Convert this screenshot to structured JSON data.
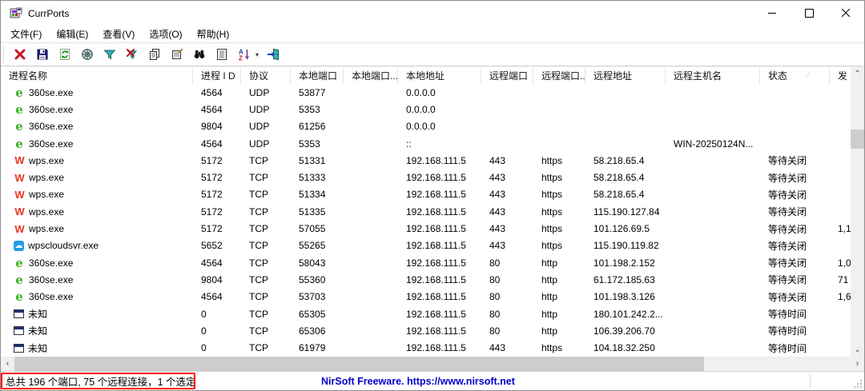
{
  "window": {
    "title": "CurrPorts"
  },
  "window_controls": {
    "minimize": "minimize",
    "maximize": "maximize",
    "close": "close"
  },
  "menu": [
    "文件(F)",
    "编辑(E)",
    "查看(V)",
    "选项(O)",
    "帮助(H)"
  ],
  "toolbar": {
    "icons": [
      "close-connection",
      "save",
      "refresh",
      "resolve-addresses",
      "filter",
      "clear-filter",
      "copy",
      "properties",
      "find",
      "report",
      "sort-az",
      "exit"
    ]
  },
  "table": {
    "columns": [
      "进程名称",
      "进程 I D",
      "协议",
      "本地端口",
      "本地端口...",
      "本地地址",
      "远程端口",
      "远程端口...",
      "远程地址",
      "远程主机名",
      "状态",
      "发"
    ],
    "rows": [
      {
        "icon": "360se",
        "process": "360se.exe",
        "pid": "4564",
        "proto": "UDP",
        "lport": "53877",
        "lportname": "",
        "laddr": "0.0.0.0",
        "rport": "",
        "rportname": "",
        "raddr": "",
        "rhost": "",
        "state": "",
        "sent": ""
      },
      {
        "icon": "360se",
        "process": "360se.exe",
        "pid": "4564",
        "proto": "UDP",
        "lport": "5353",
        "lportname": "",
        "laddr": "0.0.0.0",
        "rport": "",
        "rportname": "",
        "raddr": "",
        "rhost": "",
        "state": "",
        "sent": ""
      },
      {
        "icon": "360se",
        "process": "360se.exe",
        "pid": "9804",
        "proto": "UDP",
        "lport": "61256",
        "lportname": "",
        "laddr": "0.0.0.0",
        "rport": "",
        "rportname": "",
        "raddr": "",
        "rhost": "",
        "state": "",
        "sent": ""
      },
      {
        "icon": "360se",
        "process": "360se.exe",
        "pid": "4564",
        "proto": "UDP",
        "lport": "5353",
        "lportname": "",
        "laddr": "::",
        "rport": "",
        "rportname": "",
        "raddr": "",
        "rhost": "WIN-20250124N...",
        "state": "",
        "sent": ""
      },
      {
        "icon": "wps",
        "process": "wps.exe",
        "pid": "5172",
        "proto": "TCP",
        "lport": "51331",
        "lportname": "",
        "laddr": "192.168.111.5",
        "rport": "443",
        "rportname": "https",
        "raddr": "58.218.65.4",
        "rhost": "",
        "state": "等待关闭",
        "sent": ""
      },
      {
        "icon": "wps",
        "process": "wps.exe",
        "pid": "5172",
        "proto": "TCP",
        "lport": "51333",
        "lportname": "",
        "laddr": "192.168.111.5",
        "rport": "443",
        "rportname": "https",
        "raddr": "58.218.65.4",
        "rhost": "",
        "state": "等待关闭",
        "sent": ""
      },
      {
        "icon": "wps",
        "process": "wps.exe",
        "pid": "5172",
        "proto": "TCP",
        "lport": "51334",
        "lportname": "",
        "laddr": "192.168.111.5",
        "rport": "443",
        "rportname": "https",
        "raddr": "58.218.65.4",
        "rhost": "",
        "state": "等待关闭",
        "sent": ""
      },
      {
        "icon": "wps",
        "process": "wps.exe",
        "pid": "5172",
        "proto": "TCP",
        "lport": "51335",
        "lportname": "",
        "laddr": "192.168.111.5",
        "rport": "443",
        "rportname": "https",
        "raddr": "115.190.127.84",
        "rhost": "",
        "state": "等待关闭",
        "sent": ""
      },
      {
        "icon": "wps",
        "process": "wps.exe",
        "pid": "5172",
        "proto": "TCP",
        "lport": "57055",
        "lportname": "",
        "laddr": "192.168.111.5",
        "rport": "443",
        "rportname": "https",
        "raddr": "101.126.69.5",
        "rhost": "",
        "state": "等待关闭",
        "sent": "1,1"
      },
      {
        "icon": "wpscloud",
        "process": "wpscloudsvr.exe",
        "pid": "5652",
        "proto": "TCP",
        "lport": "55265",
        "lportname": "",
        "laddr": "192.168.111.5",
        "rport": "443",
        "rportname": "https",
        "raddr": "115.190.119.82",
        "rhost": "",
        "state": "等待关闭",
        "sent": ""
      },
      {
        "icon": "360se",
        "process": "360se.exe",
        "pid": "4564",
        "proto": "TCP",
        "lport": "58043",
        "lportname": "",
        "laddr": "192.168.111.5",
        "rport": "80",
        "rportname": "http",
        "raddr": "101.198.2.152",
        "rhost": "",
        "state": "等待关闭",
        "sent": "1,0"
      },
      {
        "icon": "360se",
        "process": "360se.exe",
        "pid": "9804",
        "proto": "TCP",
        "lport": "55360",
        "lportname": "",
        "laddr": "192.168.111.5",
        "rport": "80",
        "rportname": "http",
        "raddr": "61.172.185.63",
        "rhost": "",
        "state": "等待关闭",
        "sent": "71"
      },
      {
        "icon": "360se",
        "process": "360se.exe",
        "pid": "4564",
        "proto": "TCP",
        "lport": "53703",
        "lportname": "",
        "laddr": "192.168.111.5",
        "rport": "80",
        "rportname": "http",
        "raddr": "101.198.3.126",
        "rhost": "",
        "state": "等待关闭",
        "sent": "1,6"
      },
      {
        "icon": "unknown",
        "process": "未知",
        "pid": "0",
        "proto": "TCP",
        "lport": "65305",
        "lportname": "",
        "laddr": "192.168.111.5",
        "rport": "80",
        "rportname": "http",
        "raddr": "180.101.242.2...",
        "rhost": "",
        "state": "等待时间",
        "sent": ""
      },
      {
        "icon": "unknown",
        "process": "未知",
        "pid": "0",
        "proto": "TCP",
        "lport": "65306",
        "lportname": "",
        "laddr": "192.168.111.5",
        "rport": "80",
        "rportname": "http",
        "raddr": "106.39.206.70",
        "rhost": "",
        "state": "等待时间",
        "sent": ""
      },
      {
        "icon": "unknown",
        "process": "未知",
        "pid": "0",
        "proto": "TCP",
        "lport": "61979",
        "lportname": "",
        "laddr": "192.168.111.5",
        "rport": "443",
        "rportname": "https",
        "raddr": "104.18.32.250",
        "rhost": "",
        "state": "等待时间",
        "sent": ""
      },
      {
        "icon": "unknown",
        "process": "",
        "pid": "",
        "proto": "",
        "lport": "",
        "lportname": "",
        "laddr": "",
        "rport": "",
        "rportname": "",
        "raddr": "",
        "rhost": "",
        "state": "",
        "sent": ""
      }
    ]
  },
  "scrollbars": {
    "v_up": "⌃",
    "v_down": "⌄",
    "h_left": "‹",
    "h_right": "›"
  },
  "statusbar": {
    "summary": "总共 196 个端口, 75 个远程连接，1 个选定",
    "link": "NirSoft Freeware. https://www.nirsoft.net"
  },
  "colors": {
    "annotation_red": "#ff0000",
    "link_blue": "#0000cc",
    "process_green": "#3faf29",
    "wps_red": "#e63622",
    "cloud_blue": "#1e9de6",
    "filter_teal": "#2aa0a0"
  }
}
